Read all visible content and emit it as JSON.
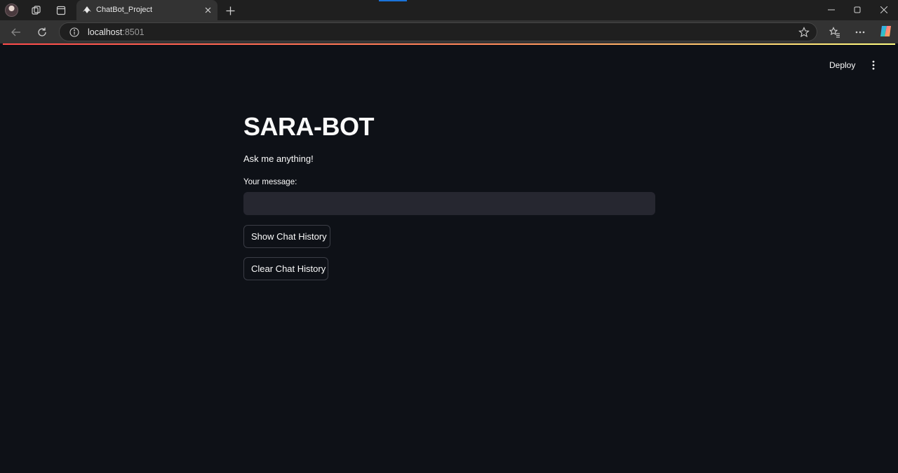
{
  "browser": {
    "tab_title": "ChatBot_Project",
    "url_host": "localhost",
    "url_port": ":8501",
    "icons": [
      "profile-avatar",
      "workspaces-icon",
      "tab-actions-icon",
      "tab-favicon",
      "close-icon",
      "plus-icon",
      "minimize-icon",
      "maximize-icon",
      "window-close-icon",
      "back-arrow-icon",
      "reload-icon",
      "info-icon",
      "star-icon",
      "favorites-icon",
      "more-icon",
      "copilot-icon"
    ]
  },
  "app": {
    "deploy_label": "Deploy",
    "title": "SARA-BOT",
    "subtitle": "Ask me anything!",
    "message_label": "Your message:",
    "message_value": "",
    "show_history_label": "Show Chat History",
    "clear_history_label": "Clear Chat History",
    "colors": {
      "background": "#0e1117",
      "input_bg": "#262730",
      "accent_red": "#ff4b4b",
      "accent_yellow": "#fffd80",
      "text": "#fafafa"
    }
  }
}
